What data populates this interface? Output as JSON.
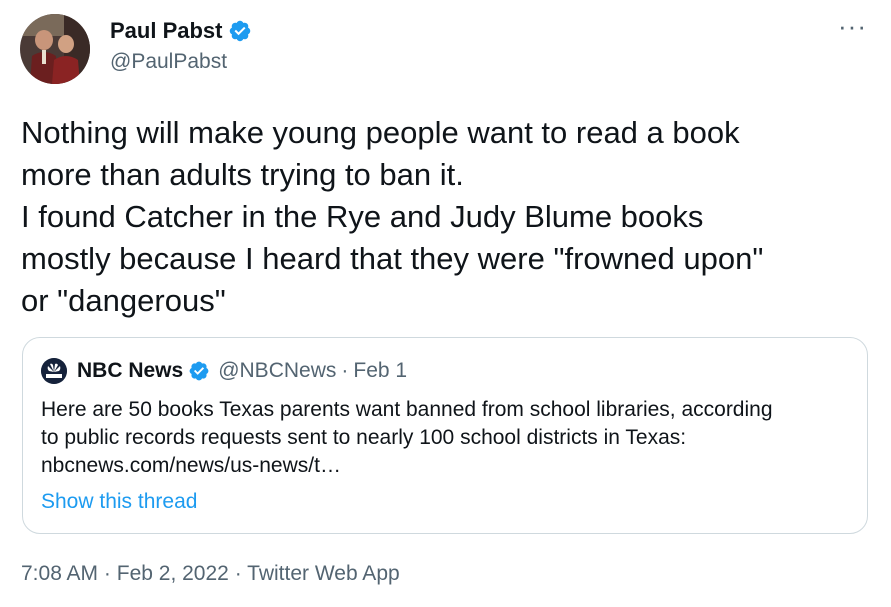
{
  "author": {
    "name": "Paul Pabst",
    "handle": "@PaulPabst"
  },
  "more_icon": "···",
  "tweet_text": "Nothing will make young people want to read a book\nmore than adults trying to ban it.\nI found Catcher in the Rye and Judy Blume books\nmostly because I heard that they were \"frowned upon\"\nor \"dangerous\"",
  "quoted": {
    "name": "NBC News",
    "handle": "@NBCNews",
    "separator": "·",
    "date": "Feb 1",
    "text_lines": [
      "Here are 50 books Texas parents want banned from school libraries, according",
      "to public records requests sent to nearly 100 school districts in Texas:",
      "nbcnews.com/news/us-news/t…"
    ],
    "show_thread": "Show this thread"
  },
  "meta": {
    "time": "7:08 AM",
    "sep1": "·",
    "date": "Feb 2, 2022",
    "sep2": "·",
    "source": "Twitter Web App"
  },
  "colors": {
    "accent": "#1d9bf0",
    "secondary_text": "#536471",
    "border": "#cfd9de"
  },
  "icons": {
    "verified": "verified-badge-icon",
    "more": "more-options-icon",
    "nbc_logo": "nbc-peacock-logo"
  }
}
